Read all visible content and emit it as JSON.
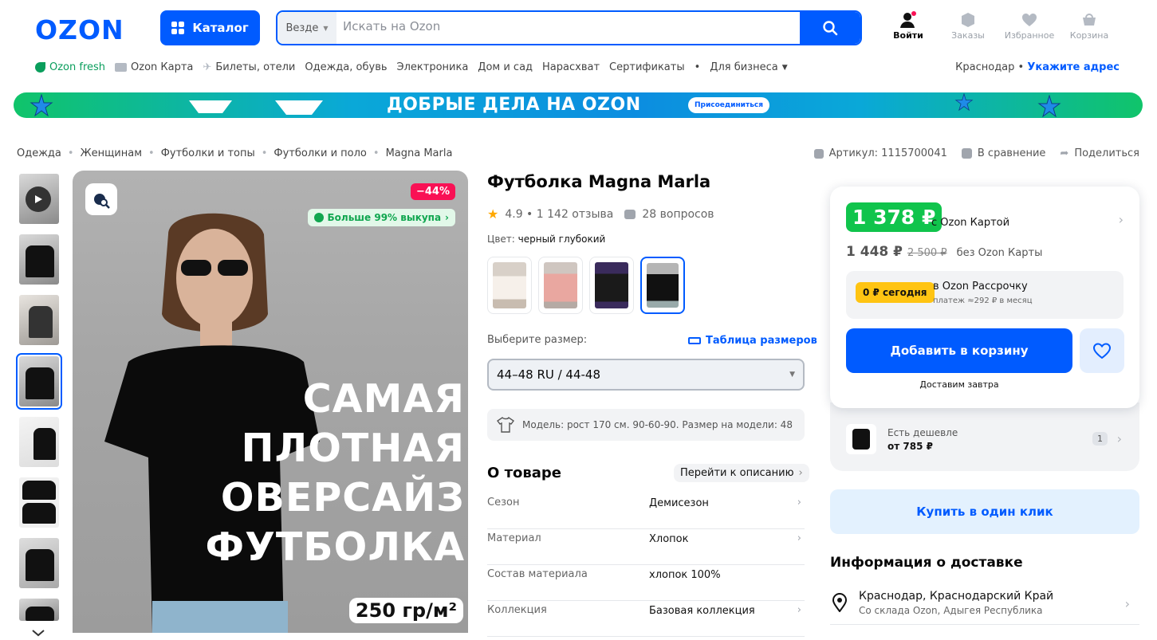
{
  "header": {
    "logo": "OZON",
    "catalog_label": "Каталог",
    "search": {
      "scope": "Везде",
      "placeholder": "Искать на Ozon"
    },
    "icons": [
      {
        "label": "Войти",
        "icon": "user-icon"
      },
      {
        "label": "Заказы",
        "icon": "box-icon"
      },
      {
        "label": "Избранное",
        "icon": "heart-icon"
      },
      {
        "label": "Корзина",
        "icon": "cart-icon"
      }
    ]
  },
  "nav": {
    "items": [
      "Ozon fresh",
      "Ozon Карта",
      "Билеты, отели",
      "Одежда, обувь",
      "Электроника",
      "Дом и сад",
      "Нарасхват",
      "Сертификаты",
      "•",
      "Для бизнеса"
    ],
    "city": "Краснодар",
    "address_link": "Укажите адрес"
  },
  "banner": {
    "title": "ДОБРЫЕ ДЕЛА НА OZON",
    "button": "Присоединиться"
  },
  "breadcrumbs": [
    "Одежда",
    "Женщинам",
    "Футболки и топы",
    "Футболки и поло",
    "Magna Marla"
  ],
  "meta": {
    "article": "Артикул: 1115700041",
    "compare": "В сравнение",
    "share": "Поделиться"
  },
  "gallery": {
    "discount": "−44%",
    "buyout": "Больше 99% выкупа",
    "promo_lines": [
      "САМАЯ",
      "ПЛОТНАЯ",
      "ОВЕРСАЙЗ",
      "ФУТБОЛКА"
    ],
    "density": "250 гр/м²"
  },
  "product": {
    "title": "Футболка Magna Marla",
    "rating": "4.9 • 1 142 отзыва",
    "questions": "28 вопросов",
    "color_label": "Цвет:",
    "color_value": "черный глубокий",
    "size_label": "Выберите размер:",
    "size_table": "Таблица размеров",
    "size_value": "44–48 RU / 44-48",
    "model_info": "Модель: рост 170 см. 90-60-90. Размер на модели: 48",
    "about_title": "О товаре",
    "goto_description": "Перейти к описанию",
    "specs": [
      {
        "key": "Сезон",
        "value": "Демисезон"
      },
      {
        "key": "Материал",
        "value": "Хлопок"
      },
      {
        "key": "Состав материала",
        "value": "хлопок 100%"
      },
      {
        "key": "Коллекция",
        "value": "Базовая коллекция"
      }
    ]
  },
  "pricing": {
    "ozon_card_price": "1 378 ₽",
    "ozon_card_label": "с Ozon Картой",
    "price": "1 448 ₽",
    "old_price": "2 500 ₽",
    "price_label": "без Ozon Карты",
    "installment_badge": "0 ₽ сегодня",
    "installment_title": "в Ozon Рассрочку",
    "installment_sub": "платеж ≈292 ₽ в месяц",
    "add_to_cart": "Добавить в корзину",
    "delivery_note": "Доставим завтра",
    "cheaper_title": "Есть дешевле",
    "cheaper_price": "от 785 ₽",
    "cheaper_count": "1",
    "one_click": "Купить в один клик"
  },
  "delivery": {
    "title": "Информация о доставке",
    "city": "Краснодар, Краснодарский Край",
    "warehouse": "Со склада Ozon, Адыгея Республика"
  },
  "colors": {
    "brand": "#005bff",
    "green": "#10c44c",
    "discount": "#f91155"
  }
}
